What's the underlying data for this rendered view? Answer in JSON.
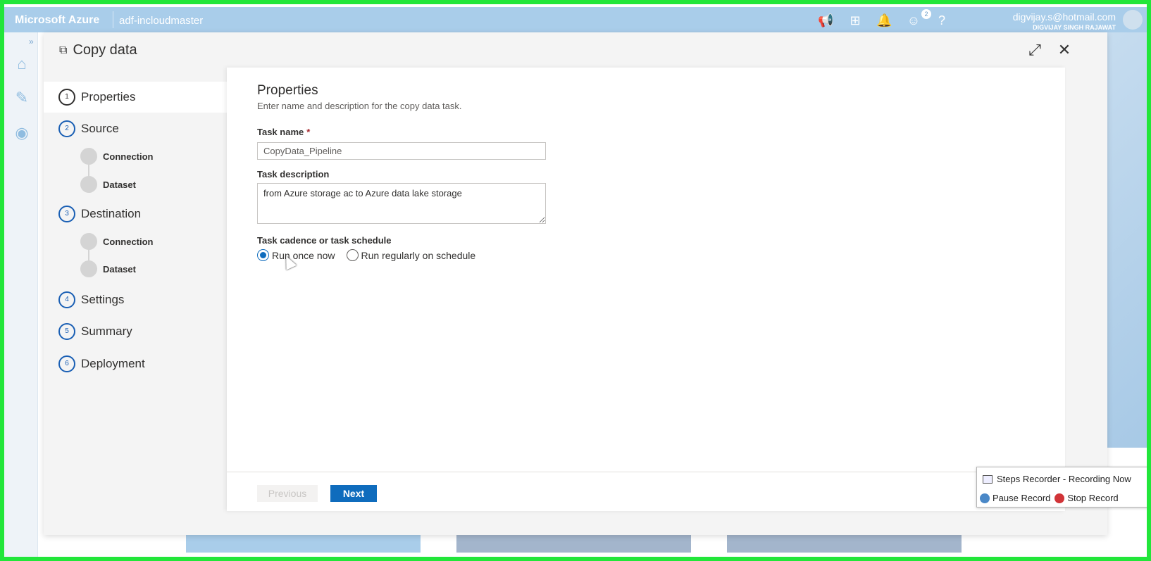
{
  "topbar": {
    "brand": "Microsoft Azure",
    "factory": "adf-incloudmaster",
    "notification_count": "2",
    "user_email": "digvijay.s@hotmail.com",
    "user_name": "DIGVIJAY SINGH RAJAWAT",
    "help": "?"
  },
  "rail": {
    "expand": "»"
  },
  "dialog": {
    "title": "Copy data",
    "steps": [
      {
        "num": "1",
        "label": "Properties"
      },
      {
        "num": "2",
        "label": "Source",
        "subs": [
          "Connection",
          "Dataset"
        ]
      },
      {
        "num": "3",
        "label": "Destination",
        "subs": [
          "Connection",
          "Dataset"
        ]
      },
      {
        "num": "4",
        "label": "Settings"
      },
      {
        "num": "5",
        "label": "Summary"
      },
      {
        "num": "6",
        "label": "Deployment"
      }
    ],
    "content": {
      "title": "Properties",
      "subtitle": "Enter name and description for the copy data task.",
      "task_name_label": "Task name",
      "required_mark": "*",
      "task_name_value": "CopyData_Pipeline",
      "task_description_label": "Task description",
      "task_description_value": "from Azure storage ac to Azure data lake storage",
      "cadence_label": "Task cadence or task schedule",
      "radio_once": "Run once now",
      "radio_schedule": "Run regularly on schedule"
    },
    "footer": {
      "previous": "Previous",
      "next": "Next"
    }
  },
  "recorder": {
    "title": "Steps Recorder - Recording Now",
    "pause": "Pause Record",
    "stop": "Stop Record"
  }
}
